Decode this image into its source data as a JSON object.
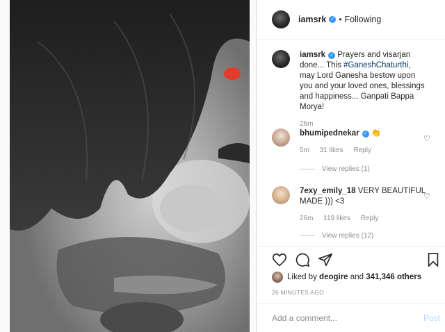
{
  "header": {
    "username": "iamsrk",
    "separator": "•",
    "follow_status": "Following"
  },
  "caption": {
    "username": "iamsrk",
    "text_before": "Prayers and visarjan done... This ",
    "hashtag": "#GaneshChaturthi",
    "text_after": ", may Lord Ganesha bestow upon you and your loved ones, blessings and happiness... Ganpati Bappa Morya!",
    "time": "26m"
  },
  "comments": [
    {
      "username": "bhumipednekar",
      "emoji": "👏",
      "text": "",
      "time": "5m",
      "likes": "31 likes",
      "reply_label": "Reply",
      "view_replies": "View replies (1)"
    },
    {
      "username": "7exy_emily_18",
      "emoji": "",
      "text": "VERY BEAUTIFUL MADE ))) <3",
      "time": "26m",
      "likes": "119 likes",
      "reply_label": "Reply",
      "view_replies": "View replies (12)"
    }
  ],
  "actions": {
    "icons": [
      "heart-icon",
      "comment-icon",
      "share-icon",
      "bookmark-icon"
    ]
  },
  "likes": {
    "prefix": "Liked by ",
    "user": "deogire",
    "middle": " and ",
    "count": "341,346 others"
  },
  "timestamp": "26 MINUTES AGO",
  "add_comment": {
    "placeholder": "Add a comment...",
    "post_label": "Post"
  },
  "colors": {
    "link": "#00376b",
    "verified": "#3897f0",
    "post_disabled": "#b3dbff",
    "muted": "#8e8e8e"
  }
}
